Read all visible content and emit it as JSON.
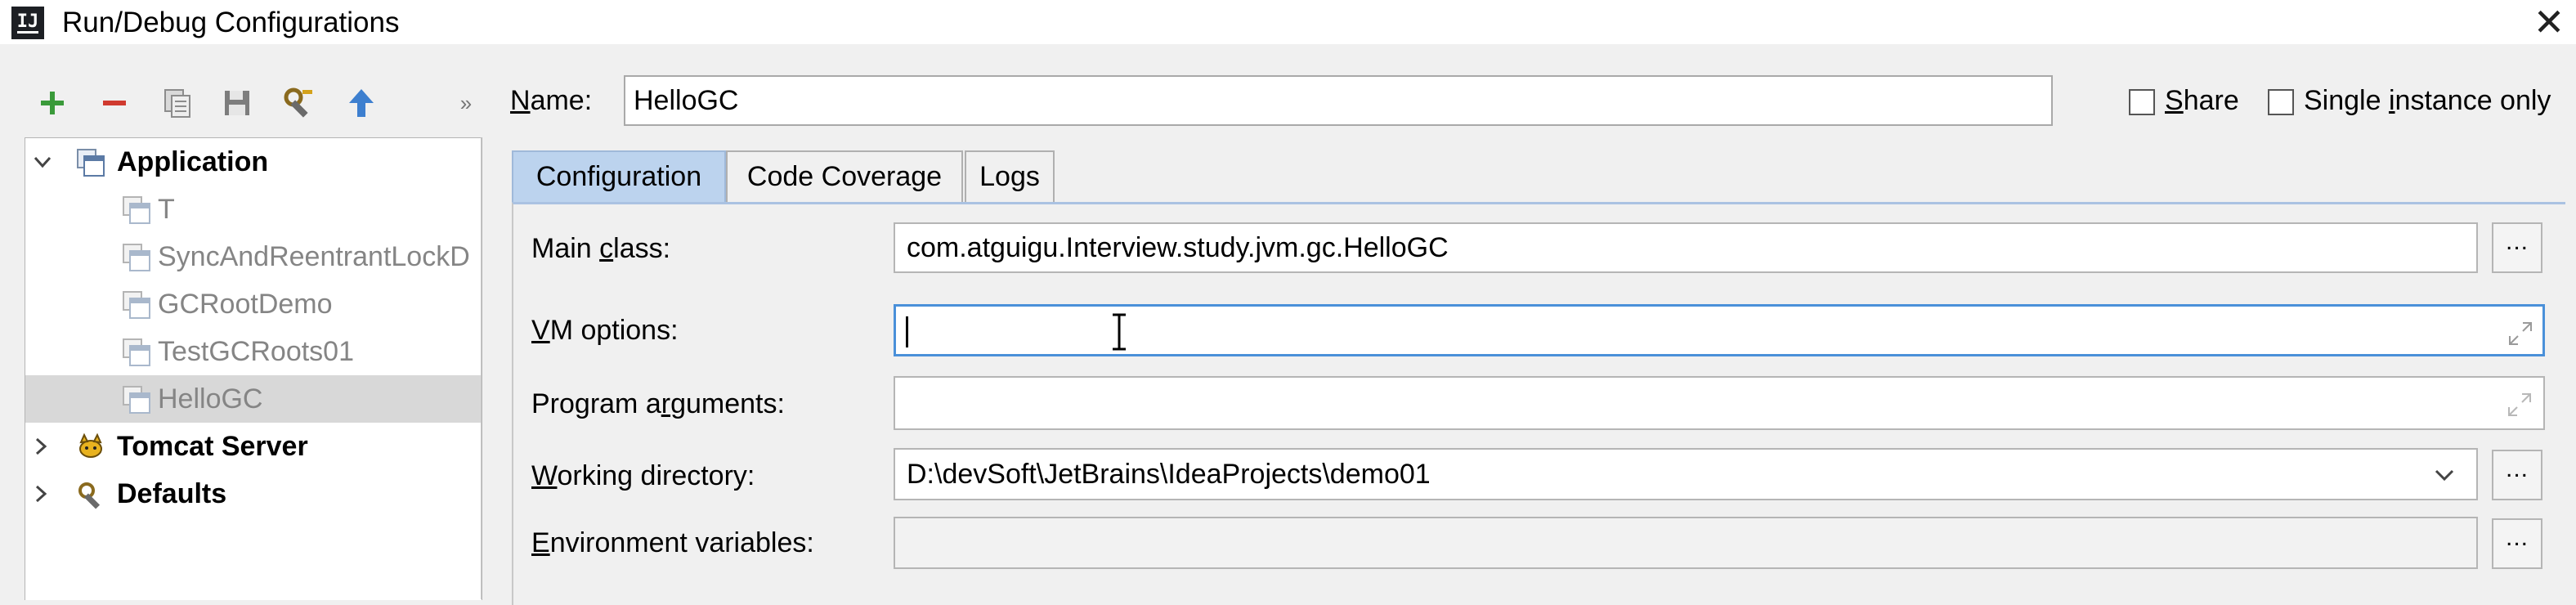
{
  "window": {
    "title": "Run/Debug Configurations",
    "app_icon_text": "IJ"
  },
  "toolbar": {
    "icons": [
      "add-icon",
      "remove-icon",
      "copy-icon",
      "save-icon",
      "edit-defaults-icon",
      "move-up-icon",
      "more-icon"
    ]
  },
  "tree": {
    "application": "Application",
    "children": [
      "T",
      "SyncAndReentrantLockD",
      "GCRootDemo",
      "TestGCRoots01",
      "HelloGC"
    ],
    "selected": "HelloGC",
    "tomcat": "Tomcat Server",
    "defaults": "Defaults"
  },
  "name": {
    "label_prefix": "",
    "label_u": "N",
    "label_rest": "ame:",
    "value": "HelloGC"
  },
  "options": {
    "share_u": "S",
    "share_rest": "hare",
    "single_a": "Single ",
    "single_u": "i",
    "single_rest": "nstance only"
  },
  "tabs": [
    "Configuration",
    "Code Coverage",
    "Logs"
  ],
  "form": {
    "main_class": {
      "a": "Main ",
      "u": "c",
      "b": "lass:",
      "value": "com.atguigu.Interview.study.jvm.gc.HelloGC",
      "button": "..."
    },
    "vm_options": {
      "u": "V",
      "b": "M options:",
      "value": ""
    },
    "program_arguments": {
      "a": "Program a",
      "u": "r",
      "b": "guments:",
      "value": ""
    },
    "working_directory": {
      "u": "W",
      "b": "orking directory:",
      "value": "D:\\devSoft\\JetBrains\\IdeaProjects\\demo01",
      "button": "..."
    },
    "environment_variables": {
      "u": "E",
      "b": "nvironment variables:",
      "value": "",
      "button": "..."
    }
  },
  "colors": {
    "accent": "#4a90d9",
    "selected_tab": "#bcd3ee",
    "add_green": "#3a9a3a",
    "remove_red": "#d03a2f",
    "up_blue": "#3d7fcf"
  }
}
